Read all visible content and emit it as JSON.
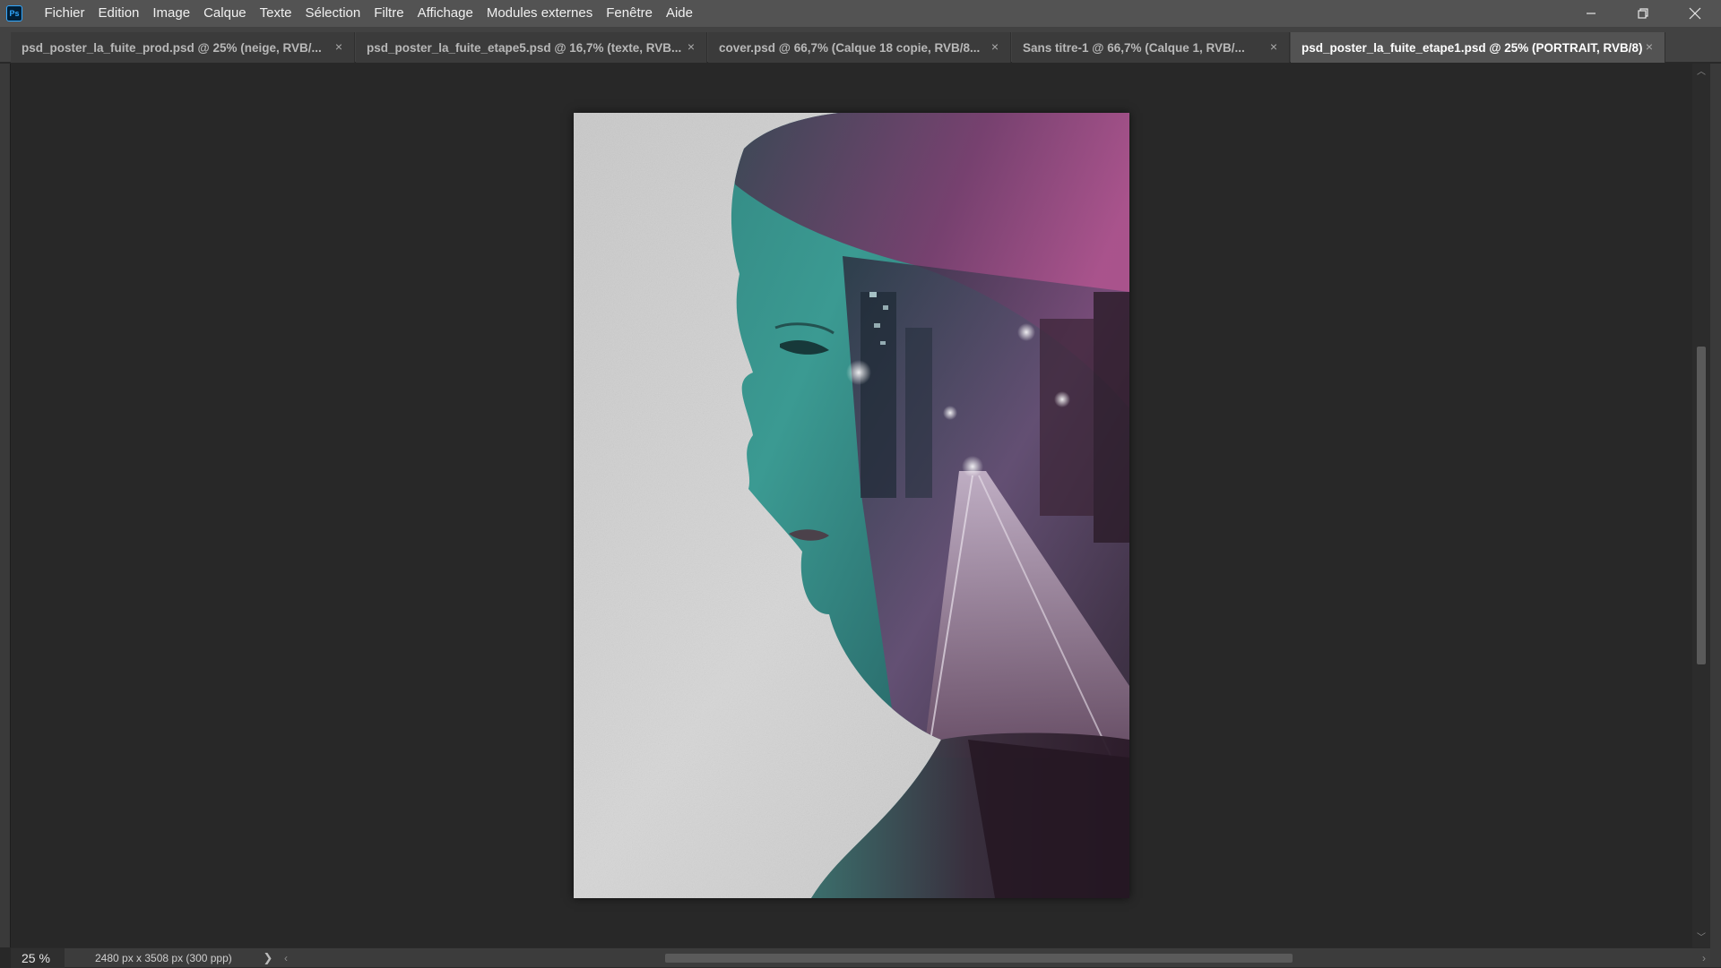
{
  "app": {
    "logo_text": "Ps",
    "menu": [
      "Fichier",
      "Edition",
      "Image",
      "Calque",
      "Texte",
      "Sélection",
      "Filtre",
      "Affichage",
      "Modules externes",
      "Fenêtre",
      "Aide"
    ]
  },
  "window_controls": {
    "minimize_icon": "minimize-icon",
    "restore_icon": "restore-icon",
    "close_icon": "close-icon"
  },
  "tabs": [
    {
      "label": "psd_poster_la_fuite_prod.psd @ 25% (neige, RVB/...",
      "active": false
    },
    {
      "label": "psd_poster_la_fuite_etape5.psd @ 16,7% (texte, RVB...",
      "active": false
    },
    {
      "label": "cover.psd @ 66,7% (Calque 18 copie, RVB/8...",
      "active": false
    },
    {
      "label": "Sans titre-1 @ 66,7% (Calque 1, RVB/...",
      "active": false
    },
    {
      "label": "psd_poster_la_fuite_etape1.psd @ 25% (PORTRAIT, RVB/8)",
      "active": true
    }
  ],
  "tab_close_glyph": "×",
  "status": {
    "zoom": "25 %",
    "doc_info": "2480 px x 3508 px (300 ppp)",
    "more_arrow": "❯"
  },
  "colors": {
    "teal_face": "#3a8f88",
    "magenta_hair": "#9a3f78",
    "paper": "#d2d2d2"
  }
}
